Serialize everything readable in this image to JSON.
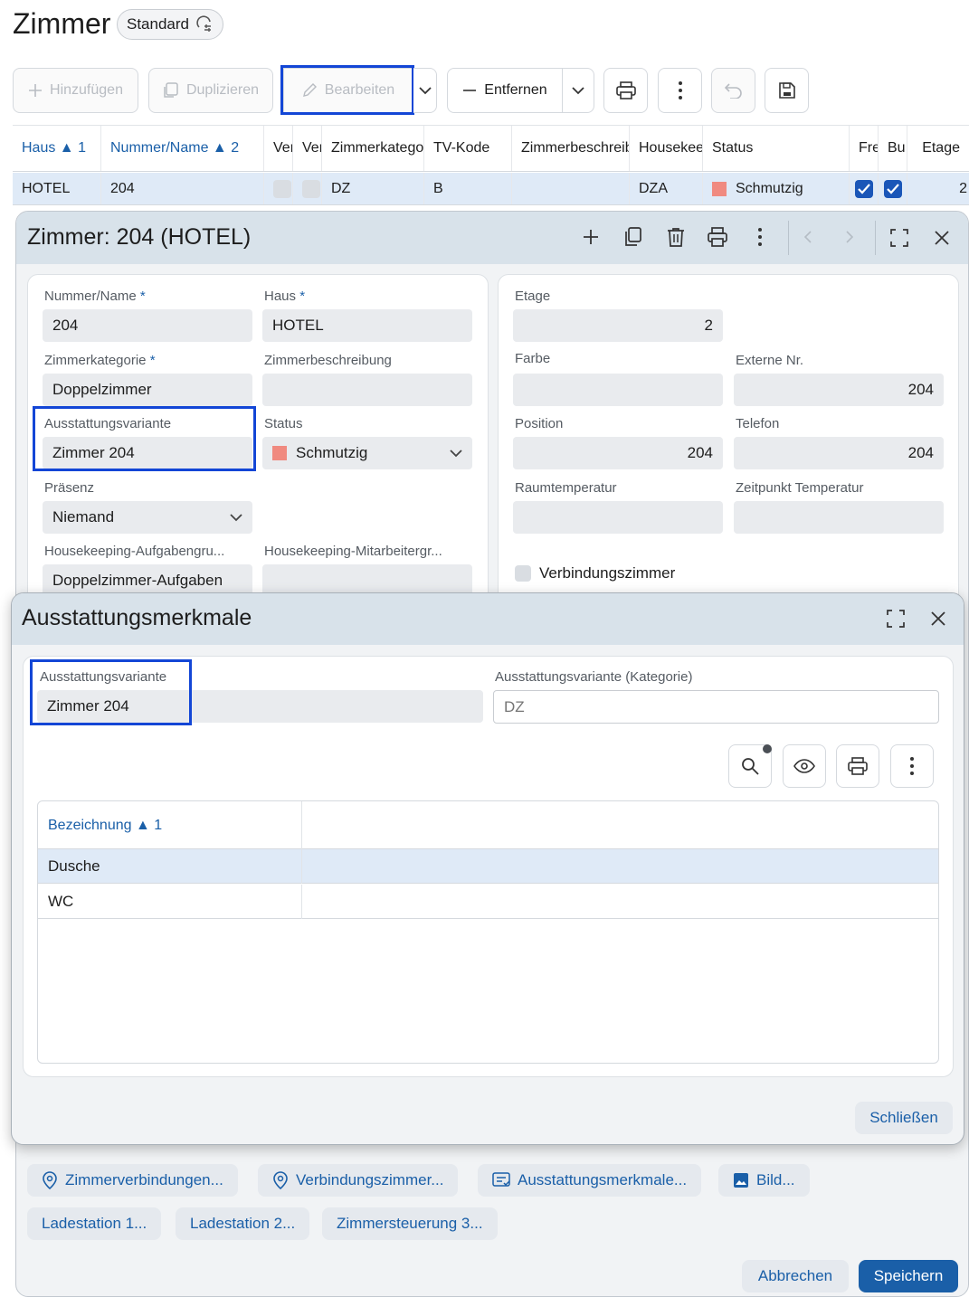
{
  "page": {
    "title": "Zimmer",
    "view_name": "Standard"
  },
  "toolbar": {
    "add_label": "Hinzufügen",
    "duplicate_label": "Duplizieren",
    "edit_label": "Bearbeiten",
    "remove_label": "Entfernen"
  },
  "grid": {
    "columns": [
      {
        "label": "Haus",
        "sort": "1"
      },
      {
        "label": "Nummer/Name",
        "sort": "2"
      },
      {
        "label": "Ver"
      },
      {
        "label": "Ver"
      },
      {
        "label": "Zimmerkatego"
      },
      {
        "label": "TV-Kode"
      },
      {
        "label": "Zimmerbeschreib"
      },
      {
        "label": "Housekee"
      },
      {
        "label": "Status"
      },
      {
        "label": "Fre"
      },
      {
        "label": "Bu"
      },
      {
        "label": "Etage"
      }
    ],
    "row": {
      "haus": "HOTEL",
      "nummer": "204",
      "kategorie": "DZ",
      "tv_kode": "B",
      "beschreibung": "",
      "housekeeping": "DZA",
      "status": "Schmutzig",
      "etage": "2"
    },
    "status_color": "#f08a80"
  },
  "room_dialog": {
    "title": "Zimmer: 204 (HOTEL)",
    "left": {
      "nummer_label": "Nummer/Name",
      "nummer_value": "204",
      "haus_label": "Haus",
      "haus_value": "HOTEL",
      "kategorie_label": "Zimmerkategorie",
      "kategorie_value": "Doppelzimmer",
      "beschreibung_label": "Zimmerbeschreibung",
      "beschreibung_value": "",
      "variante_label": "Ausstattungsvariante",
      "variante_value": "Zimmer 204",
      "status_label": "Status",
      "status_value": "Schmutzig",
      "praesenz_label": "Präsenz",
      "praesenz_value": "Niemand",
      "hk_aufgaben_label": "Housekeeping-Aufgabengru...",
      "hk_aufgaben_value": "Doppelzimmer-Aufgaben",
      "hk_mitarbeiter_label": "Housekeeping-Mitarbeitergr...",
      "hk_mitarbeiter_value": ""
    },
    "right": {
      "etage_label": "Etage",
      "etage_value": "2",
      "farbe_label": "Farbe",
      "farbe_value": "",
      "externe_label": "Externe Nr.",
      "externe_value": "204",
      "position_label": "Position",
      "position_value": "204",
      "telefon_label": "Telefon",
      "telefon_value": "204",
      "raumtemp_label": "Raumtemperatur",
      "raumtemp_value": "",
      "zeitpunkt_label": "Zeitpunkt Temperatur",
      "zeitpunkt_value": "",
      "verbindung_label": "Verbindungszimmer"
    },
    "chips": [
      "Zimmerverbindungen...",
      "Verbindungszimmer...",
      "Ausstattungsmerkmale...",
      "Bild...",
      "Ladestation 1...",
      "Ladestation 2...",
      "Zimmersteuerung 3..."
    ],
    "cancel_label": "Abbrechen",
    "save_label": "Speichern"
  },
  "features_dialog": {
    "title": "Ausstattungsmerkmale",
    "variante_label": "Ausstattungsvariante",
    "variante_value": "Zimmer 204",
    "kategorie_label": "Ausstattungsvariante (Kategorie)",
    "kategorie_placeholder": "DZ",
    "table_header": "Bezeichnung",
    "table_sort": "1",
    "rows": [
      "Dusche",
      "WC"
    ],
    "close_label": "Schließen"
  },
  "colors": {
    "accent": "#1a5fa8",
    "highlight": "#1346d6",
    "save_button": "#1a5fa8",
    "selected_row": "#dfeaf7"
  }
}
